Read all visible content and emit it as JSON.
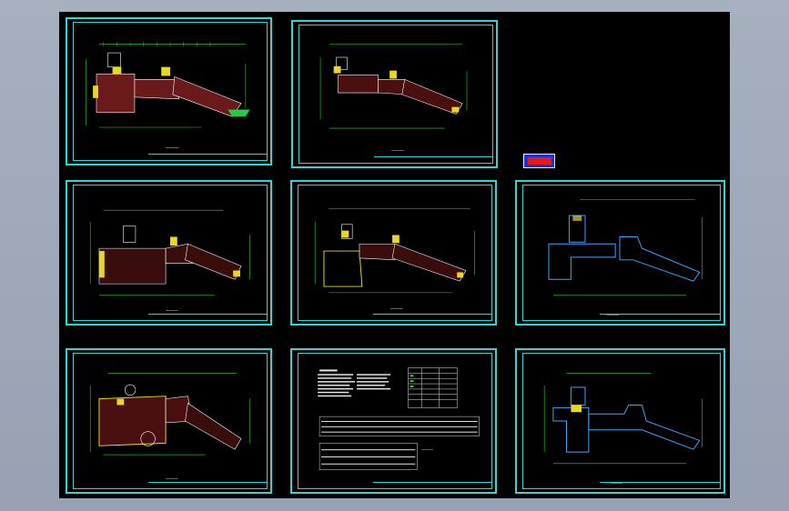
{
  "app": {
    "title": ""
  },
  "colors": {
    "background": "#000000",
    "frame": "#2fd6d6",
    "grid": "#22dd22",
    "wall": "#ffffff",
    "hatch": "#e02020",
    "core": "#e8d820",
    "outline": "#3aa6ff"
  },
  "sheets": [
    {
      "id": "plan-1",
      "caption": ""
    },
    {
      "id": "plan-2",
      "caption": ""
    },
    {
      "id": "plan-3",
      "caption": ""
    },
    {
      "id": "plan-4",
      "caption": ""
    },
    {
      "id": "plan-5",
      "caption": ""
    },
    {
      "id": "plan-6",
      "caption": ""
    },
    {
      "id": "notes-sheet",
      "caption": ""
    },
    {
      "id": "plan-7",
      "caption": ""
    }
  ],
  "legend": {
    "label": ""
  }
}
